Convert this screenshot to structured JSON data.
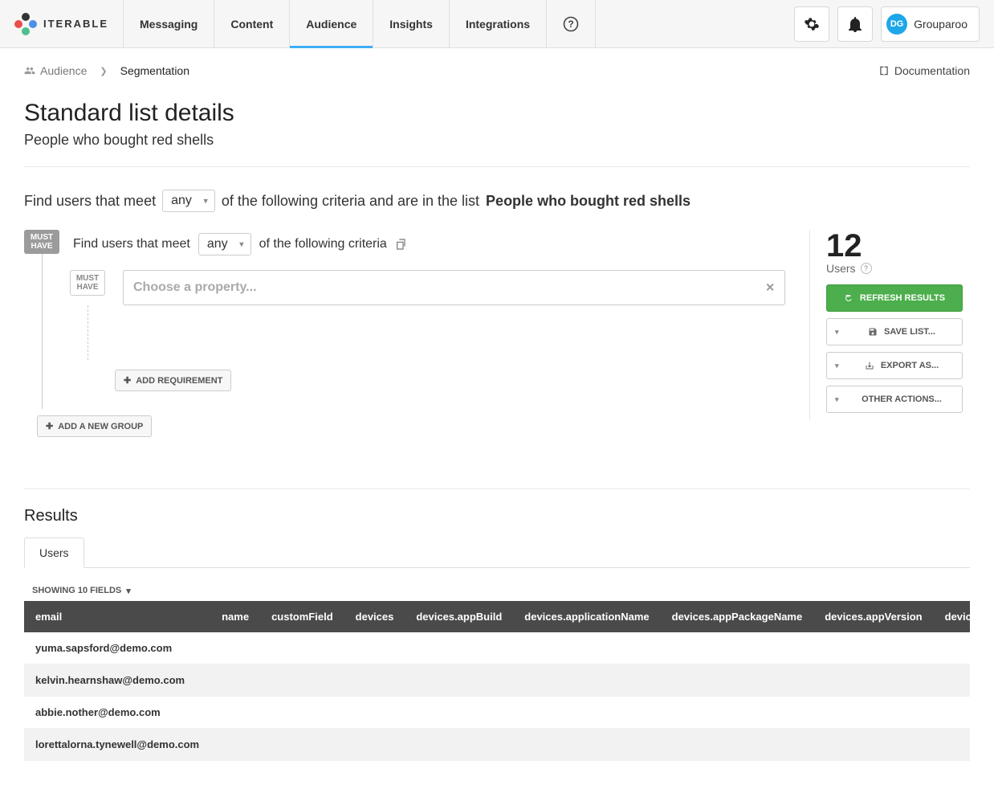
{
  "brand": "ITERABLE",
  "nav": {
    "items": [
      "Messaging",
      "Content",
      "Audience",
      "Insights",
      "Integrations"
    ],
    "active_index": 2
  },
  "user": {
    "initials": "DG",
    "name": "Grouparoo"
  },
  "doc_link": "Documentation",
  "breadcrumb": {
    "root": "Audience",
    "current": "Segmentation"
  },
  "page": {
    "title": "Standard list details",
    "subtitle": "People who bought red shells"
  },
  "filter": {
    "prefix": "Find users that meet",
    "match": "any",
    "mid": "of the following criteria and are in the list",
    "list_name": "People who bought red shells"
  },
  "builder": {
    "badge": "MUST\nHAVE",
    "inner_prefix": "Find users that meet",
    "inner_match": "any",
    "inner_suffix": "of the following criteria",
    "requirement_badge": "MUST\nHAVE",
    "property_placeholder": "Choose a property...",
    "add_requirement": "ADD REQUIREMENT",
    "add_group": "ADD A NEW GROUP"
  },
  "side": {
    "count": "12",
    "label": "Users",
    "refresh": "REFRESH RESULTS",
    "save": "SAVE LIST...",
    "export": "EXPORT AS...",
    "other": "OTHER ACTIONS..."
  },
  "results": {
    "title": "Results",
    "tab": "Users",
    "fields_label": "SHOWING 10 FIELDS",
    "columns": [
      "email",
      "name",
      "customField",
      "devices",
      "devices.appBuild",
      "devices.applicationName",
      "devices.appPackageName",
      "devices.appVersion",
      "devices.de"
    ],
    "rows": [
      {
        "email": "yuma.sapsford@demo.com"
      },
      {
        "email": "kelvin.hearnshaw@demo.com"
      },
      {
        "email": "abbie.nother@demo.com"
      },
      {
        "email": "lorettalorna.tynewell@demo.com"
      }
    ]
  }
}
